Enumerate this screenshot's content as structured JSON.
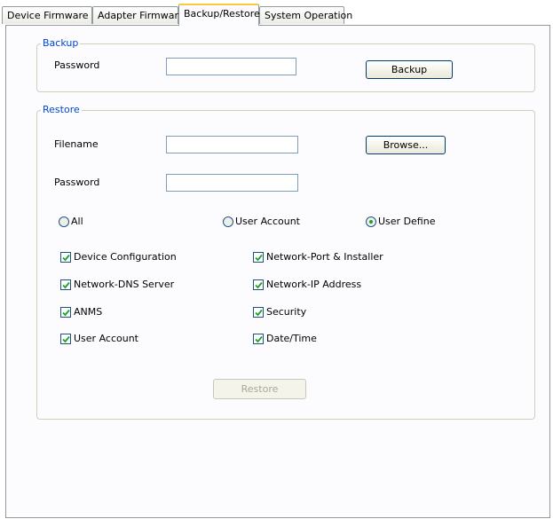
{
  "tabs": [
    {
      "label": "Device Firmware"
    },
    {
      "label": "Adapter Firmware"
    },
    {
      "label": "Backup/Restore"
    },
    {
      "label": "System Operation"
    }
  ],
  "backup": {
    "legend": "Backup",
    "password_label": "Password",
    "password_value": "",
    "backup_button": "Backup"
  },
  "restore": {
    "legend": "Restore",
    "filename_label": "Filename",
    "filename_value": "",
    "browse_button": "Browse...",
    "password_label": "Password",
    "password_value": "",
    "radios": [
      {
        "label": "All",
        "selected": false
      },
      {
        "label": "User Account",
        "selected": false
      },
      {
        "label": "User Define",
        "selected": true
      }
    ],
    "checkboxes": [
      {
        "label": "Device Configuration",
        "checked": true
      },
      {
        "label": "Network-Port & Installer",
        "checked": true
      },
      {
        "label": "Network-DNS Server",
        "checked": true
      },
      {
        "label": "Network-IP Address",
        "checked": true
      },
      {
        "label": "ANMS",
        "checked": true
      },
      {
        "label": "Security",
        "checked": true
      },
      {
        "label": "User Account",
        "checked": true
      },
      {
        "label": "Date/Time",
        "checked": true
      }
    ],
    "restore_button": "Restore"
  },
  "colors": {
    "accent": "#0046d5",
    "tab_highlight": "#ffc83c",
    "check": "#21a121"
  }
}
